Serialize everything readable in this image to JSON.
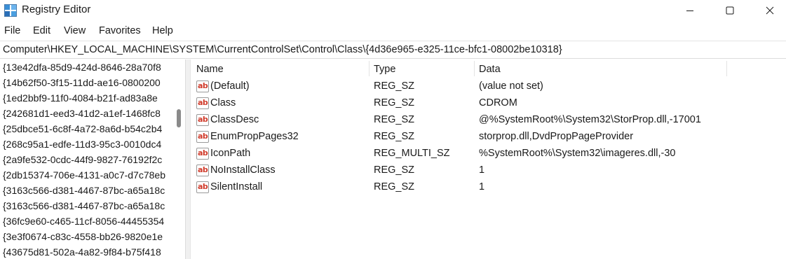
{
  "window": {
    "title": "Registry Editor",
    "icon": "registry-editor-icon",
    "controls": [
      "minimize-icon",
      "maximize-icon",
      "close-icon"
    ]
  },
  "menu": {
    "items": [
      "File",
      "Edit",
      "View",
      "Favorites",
      "Help"
    ]
  },
  "address": {
    "path": "Computer\\HKEY_LOCAL_MACHINE\\SYSTEM\\CurrentControlSet\\Control\\Class\\{4d36e965-e325-11ce-bfc1-08002be10318}"
  },
  "tree": {
    "items": [
      "{13e42dfa-85d9-424d-8646-28a70f8",
      "{14b62f50-3f15-11dd-ae16-0800200",
      "{1ed2bbf9-11f0-4084-b21f-ad83a8e",
      "{242681d1-eed3-41d2-a1ef-1468fc8",
      "{25dbce51-6c8f-4a72-8a6d-b54c2b4",
      "{268c95a1-edfe-11d3-95c3-0010dc4",
      "{2a9fe532-0cdc-44f9-9827-76192f2c",
      "{2db15374-706e-4131-a0c7-d7c78eb",
      "{3163c566-d381-4467-87bc-a65a18c",
      "{3163c566-d381-4467-87bc-a65a18c",
      "{36fc9e60-c465-11cf-8056-44455354",
      "{3e3f0674-c83c-4558-bb26-9820e1e",
      "{43675d81-502a-4a82-9f84-b75f418"
    ]
  },
  "list": {
    "headers": {
      "name": "Name",
      "type": "Type",
      "data": "Data"
    },
    "value_icon": "string-value-icon",
    "icon_text": "ab",
    "rows": [
      {
        "name": "(Default)",
        "type": "REG_SZ",
        "data": "(value not set)"
      },
      {
        "name": "Class",
        "type": "REG_SZ",
        "data": "CDROM"
      },
      {
        "name": "ClassDesc",
        "type": "REG_SZ",
        "data": "@%SystemRoot%\\System32\\StorProp.dll,-17001"
      },
      {
        "name": "EnumPropPages32",
        "type": "REG_SZ",
        "data": "storprop.dll,DvdPropPageProvider"
      },
      {
        "name": "IconPath",
        "type": "REG_MULTI_SZ",
        "data": "%SystemRoot%\\System32\\imageres.dll,-30"
      },
      {
        "name": "NoInstallClass",
        "type": "REG_SZ",
        "data": "1"
      },
      {
        "name": "SilentInstall",
        "type": "REG_SZ",
        "data": "1"
      }
    ]
  }
}
